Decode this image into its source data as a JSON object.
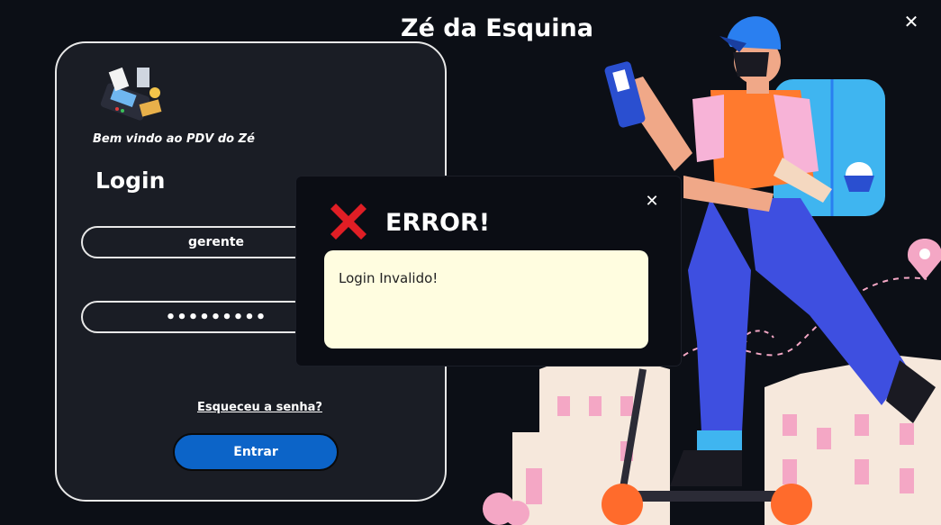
{
  "window": {
    "title": "Zé da Esquina",
    "close_icon": "close-icon"
  },
  "login": {
    "welcome": "Bem vindo ao PDV do Zé",
    "heading": "Login",
    "username_value": "gerente",
    "password_value": "•••••••••",
    "forgot_label": "Esqueceu a senha?",
    "submit_label": "Entrar"
  },
  "dialog": {
    "title": "ERROR!",
    "message": "Login Invalido!",
    "icon": "error-x-icon"
  },
  "colors": {
    "background": "#0c0f16",
    "card": "#1a1d25",
    "primary_button": "#0c64c8",
    "error_icon": "#e01e25",
    "message_box": "#fffde0"
  }
}
